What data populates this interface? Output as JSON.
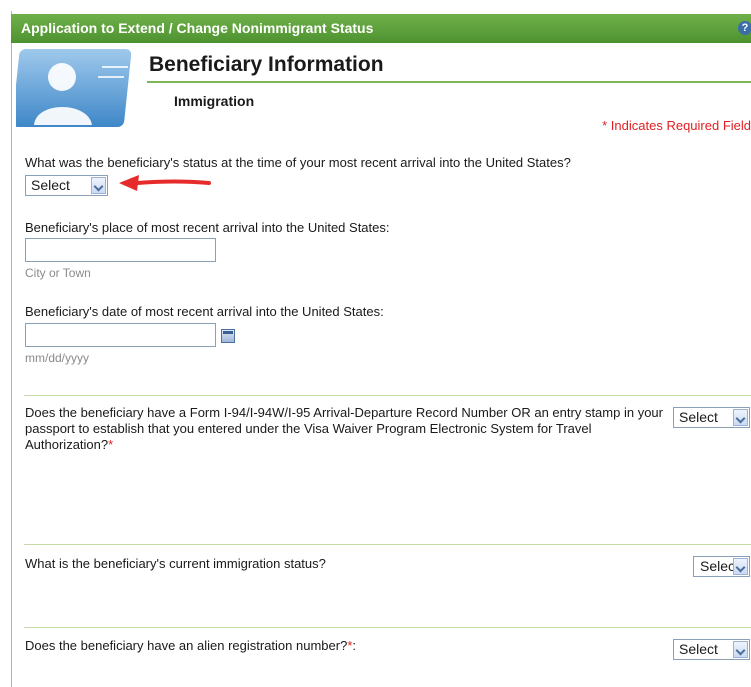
{
  "window": {
    "title": "Application to Extend / Change Nonimmigrant Status",
    "help_label": "?"
  },
  "section": {
    "title": "Beneficiary Information",
    "subtitle": "Immigration",
    "required_note": "* Indicates Required Field"
  },
  "q1": {
    "label": "What was the beneficiary's status at the time of your most recent arrival into the United States?",
    "select_value": "Select"
  },
  "q2": {
    "label": "Beneficiary's place of most recent arrival into the United States:",
    "value": "",
    "hint": "City or Town"
  },
  "q3": {
    "label": "Beneficiary's date of most recent arrival into the United States:",
    "value": "",
    "hint": "mm/dd/yyyy"
  },
  "q4": {
    "label": "Does the beneficiary have a Form I-94/I-94W/I-95 Arrival-Departure Record Number OR an entry stamp in your passport to establish that you entered under the Visa Waiver Program Electronic System for Travel Authorization?",
    "required_mark": "*",
    "select_value": "Select"
  },
  "q5": {
    "label": "What is the beneficiary's current immigration status?",
    "select_value": "Select"
  },
  "q6": {
    "label": "Does the beneficiary have an alien registration number?",
    "required_mark": "*",
    "suffix": ":",
    "select_value": "Select"
  },
  "colors": {
    "titlebar": "#5aa03a",
    "required": "#e02020",
    "annotation_arrow": "#e52b2b"
  }
}
